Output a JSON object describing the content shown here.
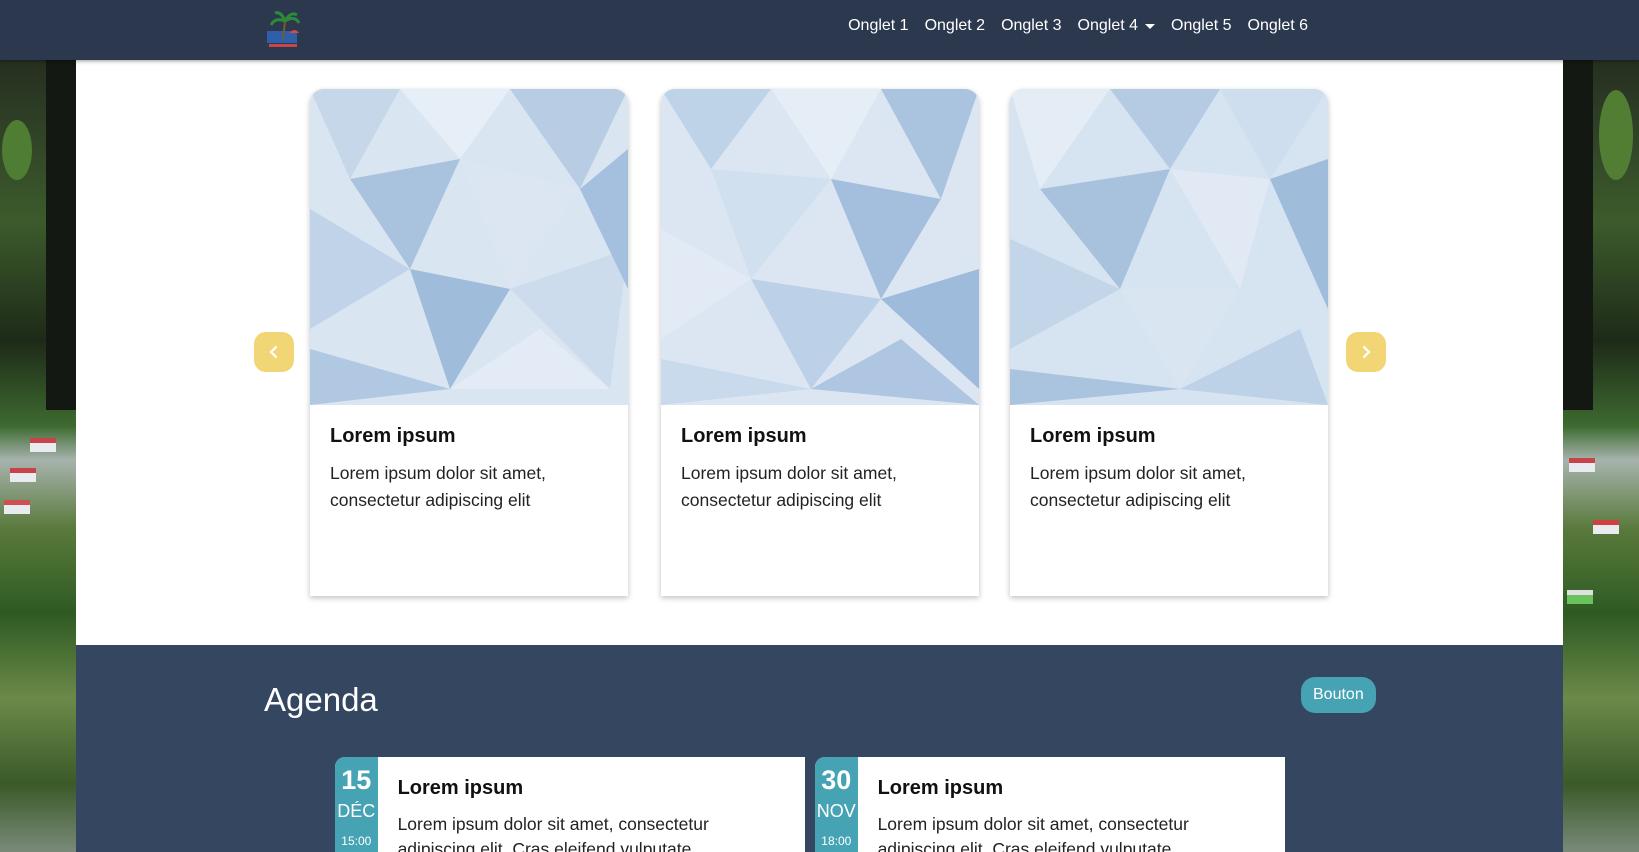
{
  "navbar": {
    "logo_alt": "logo",
    "items": [
      {
        "label": "Onglet 1"
      },
      {
        "label": "Onglet 2"
      },
      {
        "label": "Onglet 3"
      },
      {
        "label": "Onglet 4",
        "dropdown": true
      },
      {
        "label": "Onglet 5"
      },
      {
        "label": "Onglet 6"
      }
    ]
  },
  "carousel": {
    "prev_icon": "chevron-left-icon",
    "next_icon": "chevron-right-icon",
    "accent_color": "#f2d675",
    "cards": [
      {
        "title": "Lorem ipsum",
        "text": "Lorem ipsum dolor sit amet, consectetur adipiscing elit"
      },
      {
        "title": "Lorem ipsum",
        "text": "Lorem ipsum dolor sit amet, consectetur adipiscing elit"
      },
      {
        "title": "Lorem ipsum",
        "text": "Lorem ipsum dolor sit amet, consectetur adipiscing elit"
      }
    ]
  },
  "agenda": {
    "title": "Agenda",
    "button_label": "Bouton",
    "accent_color": "#45a3b4",
    "events": [
      {
        "day": "15",
        "month": "DÉC",
        "time": "15:00",
        "title": "Lorem ipsum",
        "text": "Lorem ipsum dolor sit amet, consectetur adipiscing elit. Cras eleifend vulputate"
      },
      {
        "day": "30",
        "month": "NOV",
        "time": "18:00",
        "title": "Lorem ipsum",
        "text": "Lorem ipsum dolor sit amet, consectetur adipiscing elit. Cras eleifend vulputate"
      }
    ]
  }
}
